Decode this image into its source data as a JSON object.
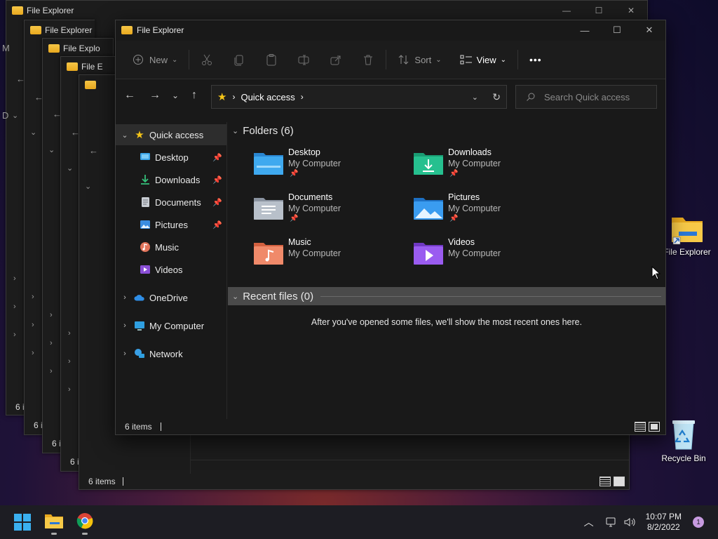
{
  "desktop": {
    "file_explorer_label": "File Explorer",
    "recycle_bin_label": "Recycle Bin"
  },
  "background_windows": {
    "title": "File Explorer",
    "titles": [
      "File Explorer",
      "File Explorer",
      "File Explo",
      "File E",
      ""
    ],
    "status_count": "6 items",
    "status_truncated": "6 i",
    "left_letters": [
      "M",
      "D"
    ]
  },
  "window": {
    "title": "File Explorer",
    "controls": {
      "minimize": "—",
      "maximize": "☐",
      "close": "✕"
    },
    "toolbar": {
      "new_label": "New",
      "sort_label": "Sort",
      "view_label": "View",
      "more_label": "•••"
    },
    "address": {
      "location": "Quick access"
    },
    "search": {
      "placeholder": "Search Quick access"
    },
    "nav": {
      "quick_access": "Quick access",
      "items": [
        {
          "label": "Desktop",
          "pinned": true
        },
        {
          "label": "Downloads",
          "pinned": true
        },
        {
          "label": "Documents",
          "pinned": true
        },
        {
          "label": "Pictures",
          "pinned": true
        },
        {
          "label": "Music",
          "pinned": false
        },
        {
          "label": "Videos",
          "pinned": false
        }
      ],
      "onedrive": "OneDrive",
      "my_computer": "My Computer",
      "network": "Network"
    },
    "folders_header": "Folders (6)",
    "folders": [
      {
        "name": "Desktop",
        "location": "My Computer",
        "pinned": true
      },
      {
        "name": "Downloads",
        "location": "My Computer",
        "pinned": true
      },
      {
        "name": "Documents",
        "location": "My Computer",
        "pinned": true
      },
      {
        "name": "Pictures",
        "location": "My Computer",
        "pinned": true
      },
      {
        "name": "Music",
        "location": "My Computer",
        "pinned": false
      },
      {
        "name": "Videos",
        "location": "My Computer",
        "pinned": false
      }
    ],
    "recent_header": "Recent files (0)",
    "recent_empty": "After you've opened some files, we'll show the most recent ones here.",
    "status": "6 items"
  },
  "taskbar": {
    "time": "10:07 PM",
    "date": "8/2/2022",
    "notification_count": "1"
  }
}
